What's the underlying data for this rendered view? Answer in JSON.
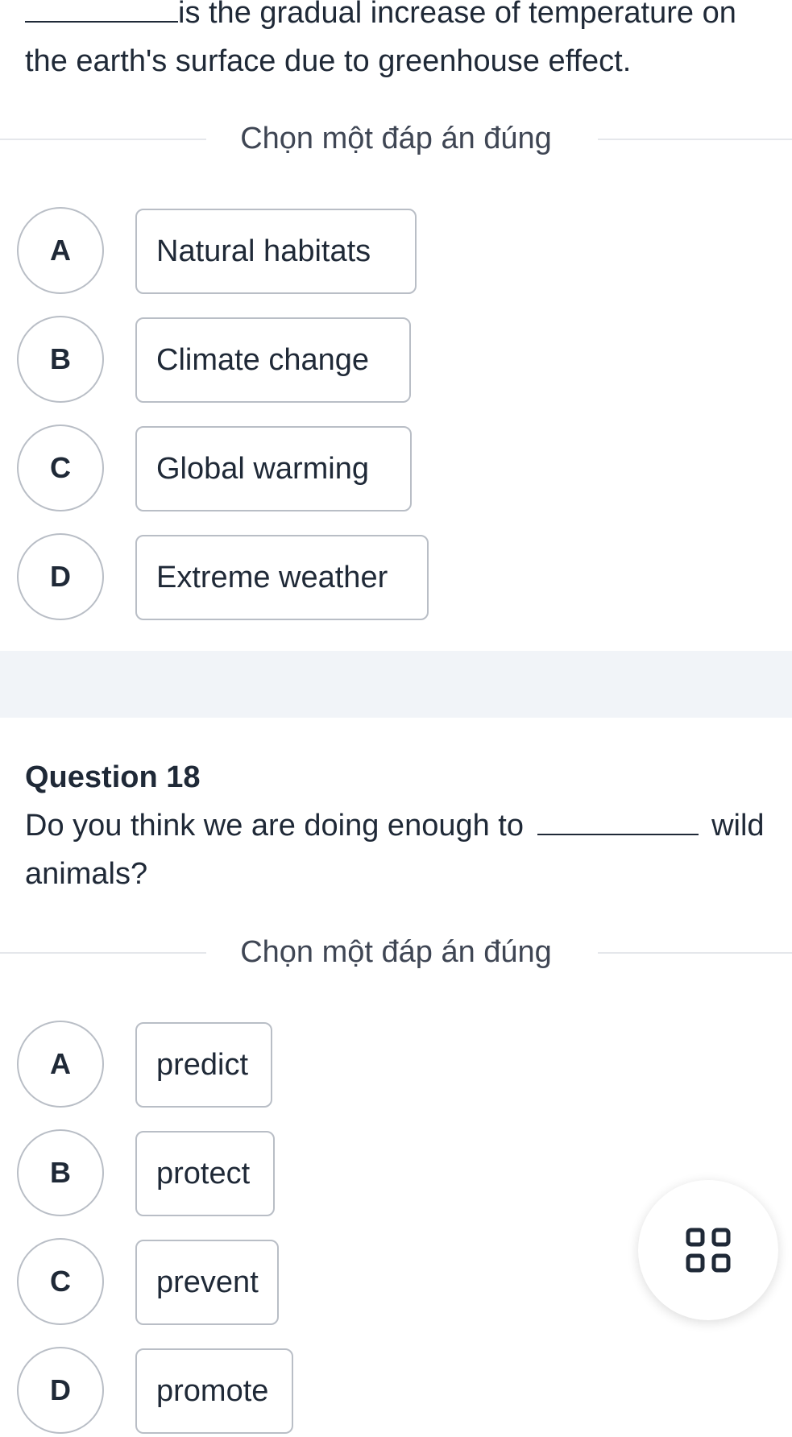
{
  "question17": {
    "text_after_blank": "is the gradual increase of temperature on",
    "text_line2": "the earth's surface due to greenhouse effect.",
    "instruction": "Chọn một đáp án đúng",
    "options": [
      {
        "letter": "A",
        "text": "Natural habitats"
      },
      {
        "letter": "B",
        "text": "Climate change"
      },
      {
        "letter": "C",
        "text": "Global warming"
      },
      {
        "letter": "D",
        "text": "Extreme weather"
      }
    ]
  },
  "question18": {
    "title": "Question 18",
    "text_before_blank": "Do you think we are doing enough to",
    "text_after_blank": "wild",
    "text_line2": "animals?",
    "instruction": "Chọn một đáp án đúng",
    "options": [
      {
        "letter": "A",
        "text": "predict"
      },
      {
        "letter": "B",
        "text": "protect"
      },
      {
        "letter": "C",
        "text": "prevent"
      },
      {
        "letter": "D",
        "text": "promote"
      }
    ]
  },
  "fab": {
    "icon": "grid-icon"
  },
  "colors": {
    "border": "#b9bec6",
    "text": "#1f2937",
    "band": "#f1f4f8",
    "divider": "#e5e7eb"
  }
}
